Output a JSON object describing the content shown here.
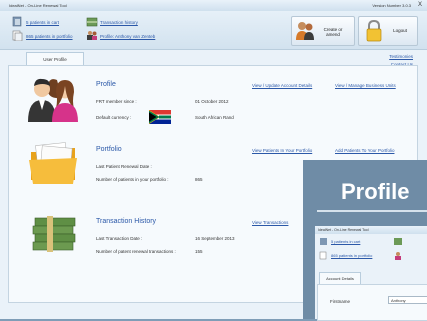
{
  "window": {
    "title": "IdealNet - On-Line Renewal Tool",
    "version": "Version Number 3.0.3",
    "close": "X"
  },
  "header": {
    "cart_link": "5 patients in cart",
    "portfolio_link": "865 patients in portfolio",
    "history_link": "Transaction history",
    "profile_link": "Profile: Anthony van Zenteb",
    "create_button": "Create or amend",
    "logout_button": "Logout"
  },
  "tabs": {
    "user_profile": "User Profile"
  },
  "top_links": {
    "testimonies": "Testimonies",
    "contact": "Contact Us"
  },
  "profile": {
    "title": "Profile",
    "member_since_label": "FRT member since :",
    "member_since_value": "01 October 2012",
    "currency_label": "Default currency :",
    "currency_value": "South African Rand",
    "update_link": "View / Update Account Details",
    "business_link": "View / Manage Business Units"
  },
  "portfolio": {
    "title": "Portfolio",
    "last_renewal_label": "Last Patient Renewal Date :",
    "last_renewal_value": "",
    "count_label": "Number of patients in your portfolio :",
    "count_value": "865",
    "view_link": "View Patients In Your Portfolio",
    "add_link": "Add Patients To Your Portfolio"
  },
  "history": {
    "title": "Transaction History",
    "last_date_label": "Last Transaction Date :",
    "last_date_value": "16 September 2013",
    "renewed_label": "Number of patent renewal transactions :",
    "renewed_value": "155",
    "view_link": "View Transactions"
  },
  "overlay": {
    "heading": "Profile",
    "window_title": "IdealNet - On-Line Renewal Tool",
    "cart_link": "5 patients in cart",
    "portfolio_link": "865 patients in portfolio",
    "tab": "Account Details",
    "field_label": "Firstname",
    "field_value": "Anthony"
  },
  "colors": {
    "accent_link": "#2b58a8",
    "background": "#7f9db7"
  }
}
